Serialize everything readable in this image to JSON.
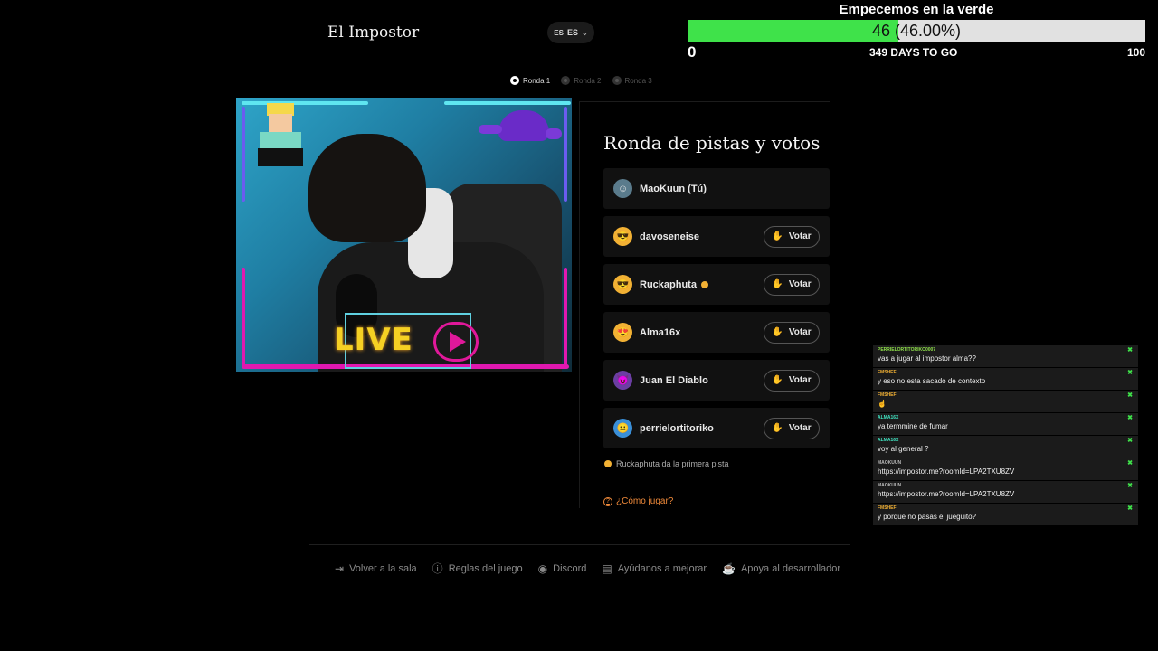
{
  "header": {
    "brand": "El Impostor",
    "lang_flag": "ES",
    "lang_label": "ES"
  },
  "goal": {
    "title": "Empecemos en la verde",
    "progress_text": "46 (46.00%)",
    "progress_fraction": 0.46,
    "min": "0",
    "days_left": "349 DAYS TO GO",
    "max": "100",
    "fill_color": "#3fe24a"
  },
  "steps": [
    {
      "label": "Ronda 1",
      "active": true
    },
    {
      "label": "Ronda 2",
      "active": false
    },
    {
      "label": "Ronda 3",
      "active": false
    }
  ],
  "webcam": {
    "overlay_text": "LIVE"
  },
  "panel": {
    "title": "Ronda de pistas y votos",
    "vote_label": "Votar",
    "players": [
      {
        "name": "MaoKuun (Tú)",
        "avatar_color": "#5a7b8c",
        "avatar_glyph": "☺",
        "votable": false,
        "first_clue": false
      },
      {
        "name": "davoseneise",
        "avatar_color": "#f2b134",
        "avatar_glyph": "😎",
        "votable": true,
        "first_clue": false
      },
      {
        "name": "Ruckaphuta",
        "avatar_color": "#f2b134",
        "avatar_glyph": "😎",
        "votable": true,
        "first_clue": true
      },
      {
        "name": "Alma16x",
        "avatar_color": "#f2b134",
        "avatar_glyph": "😍",
        "votable": true,
        "first_clue": false
      },
      {
        "name": "Juan El Diablo",
        "avatar_color": "#6b3ea3",
        "avatar_glyph": "😈",
        "votable": true,
        "first_clue": false
      },
      {
        "name": "perrielortitoriko",
        "avatar_color": "#3a8fd8",
        "avatar_glyph": "😐",
        "votable": true,
        "first_clue": false
      }
    ],
    "hint": "Ruckaphuta da la primera pista",
    "howto": "¿Cómo jugar?"
  },
  "footer": {
    "items": [
      {
        "label": "Volver a la sala",
        "icon": "exit-icon",
        "glyph": "⇥"
      },
      {
        "label": "Reglas del juego",
        "icon": "info-icon",
        "glyph": "ⓘ"
      },
      {
        "label": "Discord",
        "icon": "discord-icon",
        "glyph": "◉"
      },
      {
        "label": "Ayúdanos a mejorar",
        "icon": "feedback-icon",
        "glyph": "▤"
      },
      {
        "label": "Apoya al desarrollador",
        "icon": "coffee-icon",
        "glyph": "☕"
      }
    ]
  },
  "chat": {
    "messages": [
      {
        "user": "PERRIELORTITORIKO0007",
        "text": "vas a jugar al impostor alma??",
        "color": "#8fe04a"
      },
      {
        "user": "FMSHEF",
        "text": "y eso no esta sacado de contexto",
        "color": "#f2b134"
      },
      {
        "user": "FMSHEF",
        "text": "☝",
        "color": "#f2b134"
      },
      {
        "user": "ALMA16X",
        "text": "ya termmine de fumar",
        "color": "#3fe2c0"
      },
      {
        "user": "ALMA16X",
        "text": "voy al general ?",
        "color": "#3fe2c0"
      },
      {
        "user": "MAOKUUN",
        "text": "https://impostor.me?roomId=LPA2TXU8ZV",
        "color": "#bbbbbb"
      },
      {
        "user": "MAOKUUN",
        "text": "https://impostor.me?roomId=LPA2TXU8ZV",
        "color": "#bbbbbb"
      },
      {
        "user": "FMSHEF",
        "text": "y porque no pasas el jueguito?",
        "color": "#f2b134"
      }
    ]
  }
}
